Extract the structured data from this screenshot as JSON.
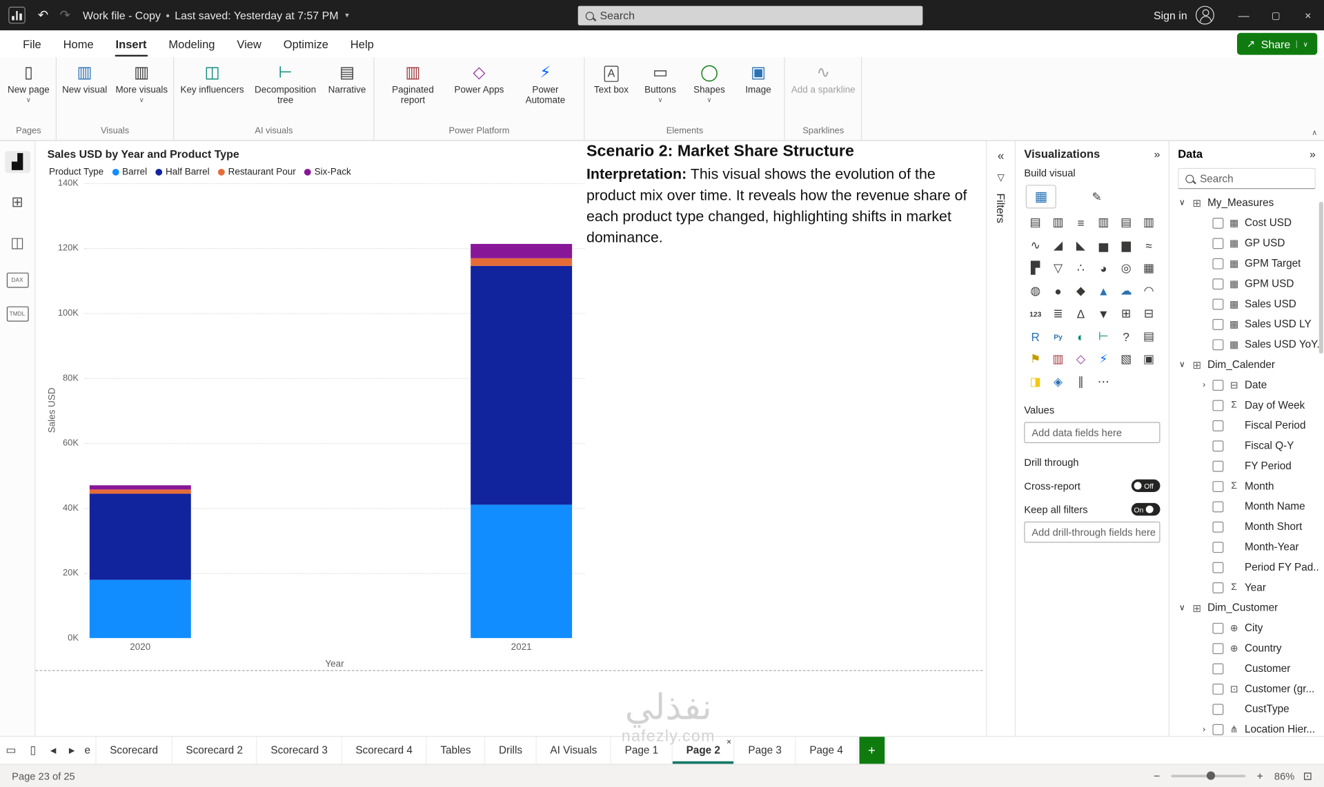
{
  "title_bar": {
    "document_title": "Work file - Copy",
    "separator": "•",
    "saved_status": "Last saved: Yesterday at 7:57 PM",
    "search_placeholder": "Search",
    "sign_in_label": "Sign in"
  },
  "menu": {
    "tabs": [
      "File",
      "Home",
      "Insert",
      "Modeling",
      "View",
      "Optimize",
      "Help"
    ],
    "selected": "Insert",
    "share_label": "Share"
  },
  "ribbon": {
    "groups": [
      {
        "label": "Pages",
        "items": [
          {
            "label": "New page",
            "icon": "new-page-icon",
            "glyph": "▯",
            "dropdown": true
          }
        ]
      },
      {
        "label": "Visuals",
        "items": [
          {
            "label": "New visual",
            "icon": "new-visual-icon",
            "glyph": "▥",
            "color": "#2a72b5"
          },
          {
            "label": "More visuals",
            "icon": "more-visuals-icon",
            "glyph": "▥",
            "dropdown": true
          }
        ]
      },
      {
        "label": "AI visuals",
        "items": [
          {
            "label": "Key influencers",
            "icon": "key-influencers-icon",
            "glyph": "◫",
            "color": "#018574"
          },
          {
            "label": "Decomposition tree",
            "icon": "decomposition-tree-icon",
            "glyph": "⊢",
            "color": "#018574"
          },
          {
            "label": "Narrative",
            "icon": "narrative-icon",
            "glyph": "▤"
          }
        ]
      },
      {
        "label": "Power Platform",
        "items": [
          {
            "label": "Paginated report",
            "icon": "paginated-report-icon",
            "glyph": "▥",
            "color": "#a4373a"
          },
          {
            "label": "Power Apps",
            "icon": "power-apps-icon",
            "glyph": "◇",
            "color": "#952f9e"
          },
          {
            "label": "Power Automate",
            "icon": "power-automate-icon",
            "glyph": "⚡",
            "color": "#0066ff"
          }
        ]
      },
      {
        "label": "Elements",
        "items": [
          {
            "label": "Text box",
            "icon": "text-box-icon",
            "glyph": "A",
            "boxed": true
          },
          {
            "label": "Buttons",
            "icon": "buttons-icon",
            "glyph": "▭",
            "dropdown": true
          },
          {
            "label": "Shapes",
            "icon": "shapes-icon",
            "glyph": "◯",
            "dropdown": true,
            "color": "#107c10"
          },
          {
            "label": "Image",
            "icon": "image-icon",
            "glyph": "▣",
            "color": "#2a72b5"
          }
        ]
      },
      {
        "label": "Sparklines",
        "items": [
          {
            "label": "Add a sparkline",
            "icon": "sparkline-icon",
            "glyph": "∿",
            "disabled": true
          }
        ]
      }
    ]
  },
  "left_nav": {
    "items": [
      {
        "name": "report-view",
        "glyph": "▟",
        "active": true
      },
      {
        "name": "table-view",
        "glyph": "⊞"
      },
      {
        "name": "model-view",
        "glyph": "◫"
      },
      {
        "name": "dax-query-view",
        "glyph": "DAX",
        "text": true
      },
      {
        "name": "tmdl-view",
        "glyph": "TMDL",
        "text": true
      }
    ]
  },
  "canvas": {
    "text_box": {
      "title": "Scenario 2: Market Share Structure",
      "interpretation_label": "Interpretation:",
      "body": "This visual shows the evolution of the product mix over time. It reveals how the revenue share of each product type changed, highlighting shifts in market dominance."
    }
  },
  "chart_data": {
    "type": "bar",
    "stacked": true,
    "title": "Sales USD by Year and Product Type",
    "categories": [
      "2020",
      "2021"
    ],
    "series": [
      {
        "name": "Barrel",
        "color": "#118DFF",
        "values": [
          18.0,
          41.0
        ]
      },
      {
        "name": "Half Barrel",
        "color": "#12239E",
        "values": [
          26.5,
          73.5
        ]
      },
      {
        "name": "Restaurant Pour",
        "color": "#E66C37",
        "values": [
          1.2,
          2.3
        ]
      },
      {
        "name": "Six-Pack",
        "color": "#881798",
        "values": [
          1.3,
          4.5
        ]
      }
    ],
    "xlabel": "Year",
    "ylabel": "Sales USD",
    "ylim": [
      0,
      140
    ],
    "ytick_step": 20,
    "ytick_suffix": "K",
    "units": "thousands USD",
    "legend_title": "Product Type",
    "legend_position": "top",
    "grid": true
  },
  "filters_panel": {
    "title": "Filters",
    "collapse_icon": "«"
  },
  "visualizations_panel": {
    "title": "Visualizations",
    "collapse_icon": "»",
    "build_visual_label": "Build visual",
    "icons": [
      {
        "name": "stacked-bar-chart",
        "glyph": "▤"
      },
      {
        "name": "stacked-column-chart",
        "glyph": "▥"
      },
      {
        "name": "clustered-bar-chart",
        "glyph": "≡"
      },
      {
        "name": "clustered-column-chart",
        "glyph": "▥"
      },
      {
        "name": "100-percent-stacked-bar-chart",
        "glyph": "▤"
      },
      {
        "name": "100-percent-stacked-column-chart",
        "glyph": "▥"
      },
      {
        "name": "line-chart",
        "glyph": "∿"
      },
      {
        "name": "area-chart",
        "glyph": "◢"
      },
      {
        "name": "stacked-area-chart",
        "glyph": "◣"
      },
      {
        "name": "line-and-stacked-column-chart",
        "glyph": "▅"
      },
      {
        "name": "line-and-clustered-column-chart",
        "glyph": "▆"
      },
      {
        "name": "ribbon-chart",
        "glyph": "≈"
      },
      {
        "name": "waterfall-chart",
        "glyph": "▛"
      },
      {
        "name": "funnel-chart",
        "glyph": "▽"
      },
      {
        "name": "scatter-chart",
        "glyph": "∴"
      },
      {
        "name": "pie-chart",
        "glyph": "◕"
      },
      {
        "name": "donut-chart",
        "glyph": "◎"
      },
      {
        "name": "treemap",
        "glyph": "▦"
      },
      {
        "name": "map",
        "glyph": "◍"
      },
      {
        "name": "filled-map",
        "glyph": "●"
      },
      {
        "name": "shape-map",
        "glyph": "◆"
      },
      {
        "name": "azure-map",
        "glyph": "▲",
        "color": "#2a72b5"
      },
      {
        "name": "arcgis-map",
        "glyph": "☁",
        "color": "#2a72b5"
      },
      {
        "name": "gauge",
        "glyph": "◠"
      },
      {
        "name": "card",
        "glyph": "123"
      },
      {
        "name": "multi-row-card",
        "glyph": "≣"
      },
      {
        "name": "kpi",
        "glyph": "∆"
      },
      {
        "name": "slicer",
        "glyph": "▼"
      },
      {
        "name": "table",
        "glyph": "⊞"
      },
      {
        "name": "matrix",
        "glyph": "⊟"
      },
      {
        "name": "r-script-visual",
        "glyph": "R",
        "color": "#2a72b5"
      },
      {
        "name": "python-visual",
        "glyph": "Py",
        "color": "#2a72b5"
      },
      {
        "name": "key-influencers",
        "glyph": "◐",
        "color": "#018574"
      },
      {
        "name": "decomposition-tree",
        "glyph": "⊢",
        "color": "#018574"
      },
      {
        "name": "qa-visual",
        "glyph": "?"
      },
      {
        "name": "smart-narrative",
        "glyph": "▤"
      },
      {
        "name": "metrics",
        "glyph": "⚑",
        "color": "#c19c00"
      },
      {
        "name": "paginated-report",
        "glyph": "▥",
        "color": "#a4373a"
      },
      {
        "name": "power-apps-visual",
        "glyph": "◇",
        "color": "#952f9e"
      },
      {
        "name": "power-automate-visual",
        "glyph": "⚡",
        "color": "#0066ff"
      },
      {
        "name": "scorecard-visual",
        "glyph": "▧"
      },
      {
        "name": "image-visual",
        "glyph": "▣"
      },
      {
        "name": "custom-visual-1",
        "glyph": "◨",
        "color": "#f2c811"
      },
      {
        "name": "custom-visual-2",
        "glyph": "◈",
        "color": "#2a72b5"
      },
      {
        "name": "custom-visual-3",
        "glyph": "∥"
      },
      {
        "name": "get-more-visuals",
        "glyph": "⋯"
      }
    ],
    "values_label": "Values",
    "values_placeholder": "Add data fields here",
    "drill_through_label": "Drill through",
    "cross_report_label": "Cross-report",
    "cross_report_state": "Off",
    "keep_filters_label": "Keep all filters",
    "keep_filters_state": "On",
    "drill_placeholder": "Add drill-through fields here"
  },
  "data_panel": {
    "title": "Data",
    "collapse_icon": "»",
    "search_placeholder": "Search",
    "sections": [
      {
        "name": "My_Measures",
        "fields": [
          {
            "label": "Cost USD",
            "icon": "measure"
          },
          {
            "label": "GP USD",
            "icon": "measure"
          },
          {
            "label": "GPM Target",
            "icon": "measure"
          },
          {
            "label": "GPM USD",
            "icon": "measure"
          },
          {
            "label": "Sales USD",
            "icon": "measure"
          },
          {
            "label": "Sales USD LY",
            "icon": "measure"
          },
          {
            "label": "Sales USD YoY...",
            "icon": "measure"
          }
        ]
      },
      {
        "name": "Dim_Calender",
        "fields": [
          {
            "label": "Date",
            "icon": "calendar",
            "expandable": true
          },
          {
            "label": "Day of Week",
            "icon": "sigma"
          },
          {
            "label": "Fiscal Period",
            "icon": "none"
          },
          {
            "label": "Fiscal Q-Y",
            "icon": "none"
          },
          {
            "label": "FY Period",
            "icon": "none"
          },
          {
            "label": "Month",
            "icon": "sigma"
          },
          {
            "label": "Month Name",
            "icon": "none"
          },
          {
            "label": "Month Short",
            "icon": "none"
          },
          {
            "label": "Month-Year",
            "icon": "none"
          },
          {
            "label": "Period FY Pad...",
            "icon": "none"
          },
          {
            "label": "Year",
            "icon": "sigma"
          }
        ]
      },
      {
        "name": "Dim_Customer",
        "fields": [
          {
            "label": "City",
            "icon": "globe"
          },
          {
            "label": "Country",
            "icon": "globe"
          },
          {
            "label": "Customer",
            "icon": "none"
          },
          {
            "label": "Customer (gr...",
            "icon": "group"
          },
          {
            "label": "CustType",
            "icon": "none"
          },
          {
            "label": "Location Hier...",
            "icon": "hierarchy",
            "expandable": true
          }
        ]
      }
    ]
  },
  "page_tabs": {
    "left_icons": [
      {
        "name": "desktop-layout-icon",
        "glyph": "▭"
      },
      {
        "name": "mobile-layout-icon",
        "glyph": "▯"
      }
    ],
    "prev_icon": "◀",
    "next_icon": "▶",
    "tabs": [
      {
        "label": "e",
        "partial": true
      },
      {
        "label": "Scorecard"
      },
      {
        "label": "Scorecard 2"
      },
      {
        "label": "Scorecard 3"
      },
      {
        "label": "Scorecard 4"
      },
      {
        "label": "Tables"
      },
      {
        "label": "Drills"
      },
      {
        "label": "AI Visuals"
      },
      {
        "label": "Page 1"
      },
      {
        "label": "Page 2",
        "active": true,
        "closable": true
      },
      {
        "label": "Page 3"
      },
      {
        "label": "Page 4"
      }
    ],
    "add_label": "+"
  },
  "status_bar": {
    "page_indicator": "Page 23 of 25",
    "zoom_level": "86%"
  },
  "watermark": {
    "line1": "نفذلي",
    "line2": "nafezly.com"
  }
}
